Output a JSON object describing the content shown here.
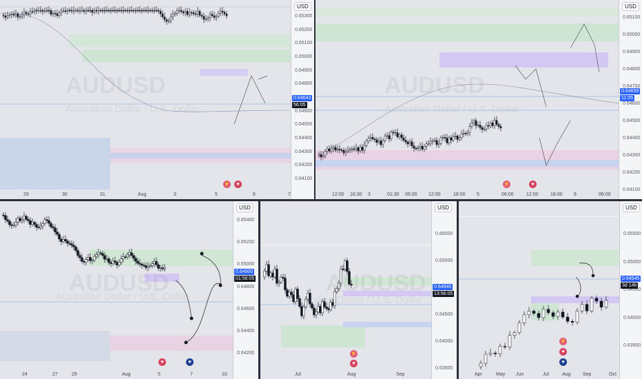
{
  "currency": "USD",
  "watermark": {
    "symbol": "AUDUSD",
    "name": "Australian Dollar / U.S. Dollar"
  },
  "icons": [
    "lightning-icon",
    "us-flag-icon",
    "au-flag-icon"
  ],
  "colors": {
    "up": "#ffffff",
    "down": "#131722",
    "price_tag": "#2962ff",
    "timer_tag": "#131722",
    "supply_zone": "#b2dfb9",
    "demand_zone": "#a7c7f0",
    "purple_zone": "#c9b8f5",
    "pink_zone": "#f4c6d6"
  },
  "panels": [
    {
      "id": "p1",
      "price_labels": [
        "0.65300",
        "0.65200",
        "0.65100",
        "0.65000",
        "0.64900",
        "0.64800",
        "0.64700",
        "0.64600",
        "0.64500",
        "0.64400",
        "0.64300",
        "0.64200",
        "0.64100"
      ],
      "price_tag": "0.64643",
      "timer": "56:05",
      "time_labels": [
        "29",
        "30",
        "31",
        "Aug",
        "3",
        "5",
        "6",
        "7"
      ]
    },
    {
      "id": "p2",
      "price_labels": [
        "0.65100",
        "0.65000",
        "0.64900",
        "0.64800",
        "0.64700",
        "0.64600",
        "0.64500",
        "0.64400",
        "0.64300",
        "0.64200",
        "0.64100"
      ],
      "price_tag": "0.64659",
      "timer": "11:05",
      "time_labels": [
        "12:00",
        "16:30",
        "3",
        "01:30",
        "06:00",
        "12:00",
        "18:00",
        "5",
        "06:00",
        "12:00",
        "18:00",
        "6",
        "06:00"
      ]
    },
    {
      "id": "p3",
      "price_labels": [
        "0.65400",
        "0.65200",
        "0.65000",
        "0.64800",
        "0.64600",
        "0.64400",
        "0.64200"
      ],
      "price_tag": "0.64900",
      "timer": "01:56:05",
      "time_labels": [
        "24",
        "27",
        "29",
        "Aug",
        "5",
        "7",
        "10"
      ]
    },
    {
      "id": "p4",
      "price_labels": [
        "0.66000",
        "0.65500",
        "0.65000",
        "0.64500",
        "0.64000",
        "0.63500"
      ],
      "price_tag": "0.64946",
      "timer": "13:56:05",
      "time_labels": [
        "Jul",
        "Aug",
        "Sep"
      ]
    },
    {
      "id": "p5",
      "price_labels": [
        "0.65500",
        "0.65000",
        "0.64500",
        "0.64000",
        "0.63500"
      ],
      "price_tag": "0.64545",
      "timer": "3d 14h",
      "time_labels": [
        "Apr",
        "May",
        "Jun",
        "Jul",
        "Aug",
        "Sep",
        "Oct"
      ]
    }
  ]
}
